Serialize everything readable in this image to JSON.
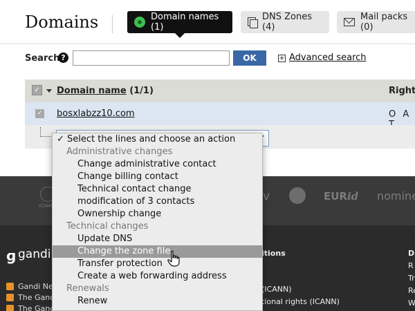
{
  "header": {
    "title": "Domains",
    "tabs": [
      {
        "label": "Domain names (1)",
        "icon": "domain-icon"
      },
      {
        "label": "DNS Zones (4)",
        "icon": "dns-zones-icon"
      },
      {
        "label": "Mail packs (0)",
        "icon": "mail-icon"
      }
    ]
  },
  "search": {
    "label": "Search",
    "value": "",
    "ok_label": "OK",
    "advanced_box": "+",
    "advanced_label": "Advanced search"
  },
  "table": {
    "col_domain": "Domain name",
    "col_domain_count": " (1/1)",
    "col_rights": "Rights",
    "rows": [
      {
        "domain": "bosxlabzz10.com",
        "rights": "O A T"
      }
    ]
  },
  "menu": {
    "items": [
      {
        "type": "check",
        "label": "✓ Select the lines and choose an action"
      },
      {
        "type": "group",
        "label": "Administrative changes"
      },
      {
        "type": "option",
        "label": "Change administrative contact"
      },
      {
        "type": "option",
        "label": "Change billing contact"
      },
      {
        "type": "option",
        "label": "Technical contact change"
      },
      {
        "type": "option",
        "label": "modification of 3 contacts"
      },
      {
        "type": "option",
        "label": "Ownership change"
      },
      {
        "type": "group",
        "label": "Technical changes"
      },
      {
        "type": "option",
        "label": "Update DNS"
      },
      {
        "type": "option",
        "label": "Change the zone file",
        "highlighted": true
      },
      {
        "type": "option",
        "label": "Transfer protection"
      },
      {
        "type": "option",
        "label": "Create a web forwarding address"
      },
      {
        "type": "group",
        "label": "Renewals"
      },
      {
        "type": "option",
        "label": "Renew"
      }
    ]
  },
  "footer": {
    "icann": "ICANN",
    "partner_v": "v",
    "eurid_main": "EUR",
    "eurid_italic": "id",
    "nominet": "nominet",
    "brand": "gandi.n",
    "feeds": [
      "Gandi Ne",
      "The Gand",
      "The Gand"
    ],
    "col3": [
      "itions",
      "",
      "(ICANN)",
      "tional rights (ICANN)"
    ],
    "col4": [
      "D",
      "R",
      "Tr",
      "Re",
      "W"
    ]
  },
  "colors": {
    "accent_blue": "#3a67a7",
    "tab_active": "#111111",
    "highlight": "#9a9a9a",
    "footer_dark": "#2b2b2b",
    "rss_orange": "#e8912a"
  }
}
